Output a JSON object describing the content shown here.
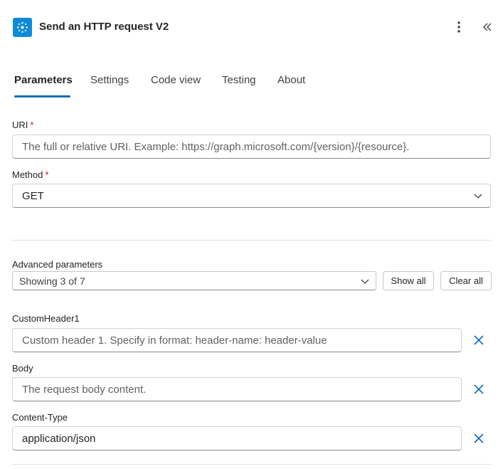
{
  "header": {
    "title": "Send an HTTP request V2",
    "icon": "http-connector-icon",
    "more_icon": "more-vertical-icon",
    "collapse_icon": "double-chevron-left-icon"
  },
  "tabs": [
    {
      "label": "Parameters",
      "active": true
    },
    {
      "label": "Settings",
      "active": false
    },
    {
      "label": "Code view",
      "active": false
    },
    {
      "label": "Testing",
      "active": false
    },
    {
      "label": "About",
      "active": false
    }
  ],
  "uri": {
    "label": "URI",
    "required_mark": "*",
    "placeholder": "The full or relative URI. Example: https://graph.microsoft.com/{version}/{resource}."
  },
  "method": {
    "label": "Method",
    "required_mark": "*",
    "value": "GET"
  },
  "advanced": {
    "label": "Advanced parameters",
    "value": "Showing 3 of 7",
    "show_all": "Show all",
    "clear_all": "Clear all"
  },
  "custom_header": {
    "label": "CustomHeader1",
    "placeholder": "Custom header 1. Specify in format: header-name: header-value"
  },
  "body": {
    "label": "Body",
    "placeholder": "The request body content."
  },
  "content_type": {
    "label": "Content-Type",
    "value": "application/json"
  },
  "colors": {
    "accent": "#0f6cbd",
    "icon_bg": "#0f8bd6",
    "required": "#c50f1f"
  }
}
